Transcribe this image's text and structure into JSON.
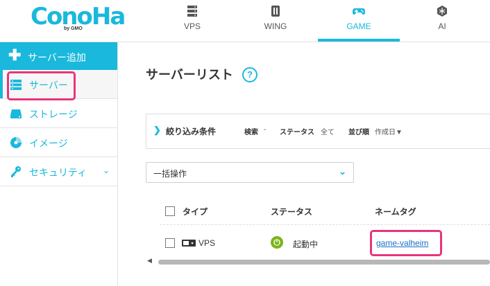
{
  "brand": {
    "name": "ConoHa",
    "sub": "by GMO"
  },
  "nav": {
    "tabs": [
      {
        "label": "VPS",
        "icon": "server-stack-icon"
      },
      {
        "label": "WING",
        "icon": "wing-cube-icon"
      },
      {
        "label": "GAME",
        "icon": "gamepad-icon",
        "active": true
      },
      {
        "label": "AI",
        "icon": "ai-chip-icon"
      }
    ]
  },
  "sidebar": {
    "add_label": "サーバー追加",
    "items": [
      {
        "label": "サーバー",
        "icon": "server-icon",
        "active": true
      },
      {
        "label": "ストレージ",
        "icon": "storage-icon"
      },
      {
        "label": "イメージ",
        "icon": "image-disc-icon"
      },
      {
        "label": "セキュリティ",
        "icon": "key-icon",
        "chevron": "⌄"
      }
    ]
  },
  "main": {
    "title": "サーバーリスト",
    "help": "?",
    "filter": {
      "title": "絞り込み条件",
      "search_label": "検索",
      "search_value": "-",
      "status_label": "ステータス",
      "status_value": "全て",
      "sort_label": "並び順",
      "sort_value": "作成日▼"
    },
    "bulk_action": {
      "value": "一括操作"
    },
    "table": {
      "headers": {
        "type": "タイプ",
        "status": "ステータス",
        "nametag": "ネームタグ"
      },
      "rows": [
        {
          "type": "VPS",
          "status": "起動中",
          "nametag": "game-valheim"
        }
      ]
    }
  },
  "colors": {
    "accent": "#1ab8dc",
    "highlight": "#e8347a",
    "running": "#7cb518",
    "link": "#1a6fc4"
  }
}
